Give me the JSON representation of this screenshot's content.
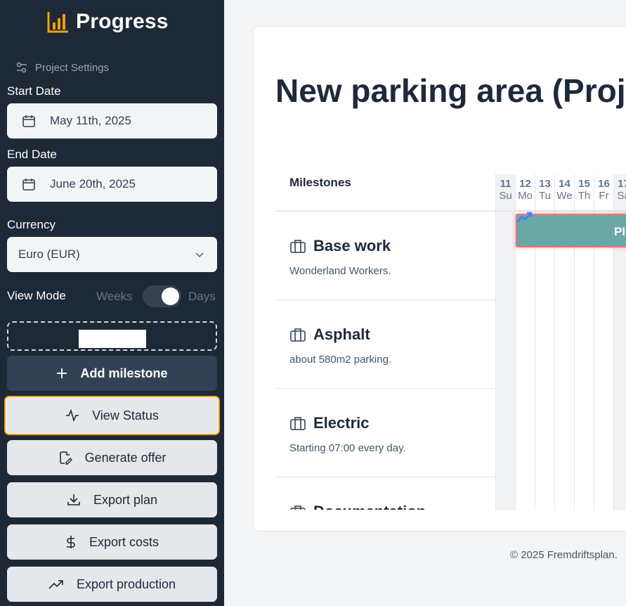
{
  "brand": {
    "title": "Progress",
    "logo_icon": "bar-chart-icon",
    "accent": "#f59e0b"
  },
  "sidebar": {
    "project_settings": "Project Settings",
    "start_date": {
      "label": "Start Date",
      "value": "May 11th, 2025"
    },
    "end_date": {
      "label": "End Date",
      "value": "June 20th, 2025"
    },
    "currency": {
      "label": "Currency",
      "value": "Euro (EUR)"
    },
    "view_mode": {
      "label": "View Mode",
      "left": "Weeks",
      "right": "Days",
      "selected": "Days"
    },
    "buttons": {
      "add_milestone": "Add milestone",
      "view_status": "View Status",
      "generate_offer": "Generate offer",
      "export_plan": "Export plan",
      "export_costs": "Export costs",
      "export_production": "Export production"
    }
  },
  "main": {
    "title": "New parking area (Proj",
    "milestones_header": "Milestones",
    "days": [
      {
        "num": "11",
        "name": "Su",
        "weekend": true
      },
      {
        "num": "12",
        "name": "Mo",
        "weekend": false
      },
      {
        "num": "13",
        "name": "Tu",
        "weekend": false
      },
      {
        "num": "14",
        "name": "We",
        "weekend": false
      },
      {
        "num": "15",
        "name": "Th",
        "weekend": false
      },
      {
        "num": "16",
        "name": "Fr",
        "weekend": false
      },
      {
        "num": "17",
        "name": "Sa",
        "weekend": true
      }
    ],
    "milestones": [
      {
        "title": "Base work",
        "subtitle": "Wonderland Workers."
      },
      {
        "title": "Asphalt",
        "subtitle": "about 580m2 parking."
      },
      {
        "title": "Electric",
        "subtitle": "Starting 07:00 every day."
      },
      {
        "title": "Documentation",
        "subtitle": ""
      }
    ],
    "bar_label": "Pl"
  },
  "footer": "© 2025 Fremdriftsplan."
}
